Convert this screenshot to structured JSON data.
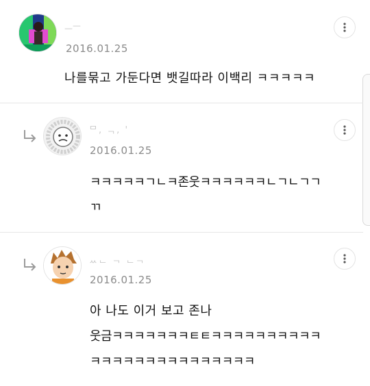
{
  "comments": [
    {
      "username": "ᅟᅳᅳ",
      "date": "2016.01.25",
      "lines": [
        "나를묶고 가둔다면 뱃길따라 이백리 ㅋㅋㅋㅋㅋ"
      ]
    },
    {
      "username": "ᄆ,   ᆨ,  '   ",
      "date": "2016.01.25",
      "lines": [
        "ㅋㅋㅋㅋㅋㄱㄴㅋ존웃ㅋㅋㅋㅋㅋㅋㄴㄱㄴㄱㄱ",
        "ㄲ"
      ]
    },
    {
      "username": "ᆻᆫ  ᆨ  ᆫᆨ",
      "date": "2016.01.25",
      "lines": [
        "아 나도 이거 보고 존나",
        "웃금ㅋㅋㅋㅋㅋㅋㅋㅌㅌㅋㅋㅋㅋㅋㅋㅋㅋㅋㅋ",
        "ㅋㅋㅋㅋㅋㅋㅋㅋㅋㅋㅋㅋㅋㅋㅋ"
      ]
    }
  ],
  "icons": {
    "more": "more-vertical-icon",
    "reply": "reply-arrow-icon"
  }
}
